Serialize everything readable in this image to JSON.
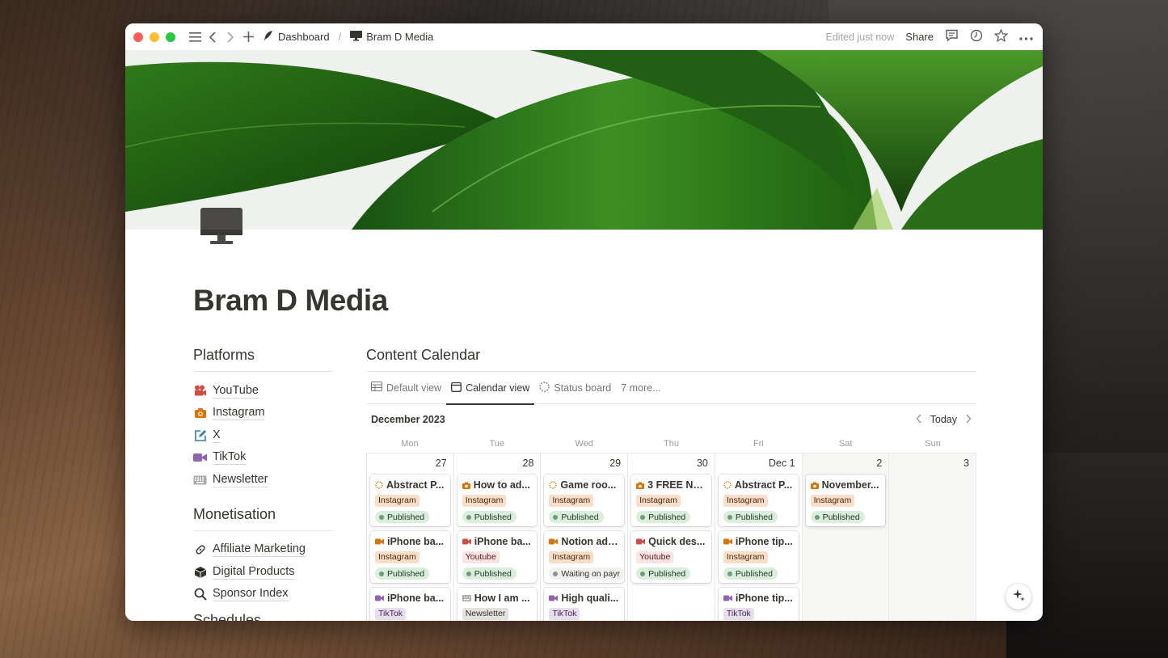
{
  "titlebar": {
    "breadcrumb_root": "Dashboard",
    "breadcrumb_separator": "/",
    "breadcrumb_page": "Bram D Media",
    "edited": "Edited just now",
    "share": "Share"
  },
  "page": {
    "title": "Bram D Media"
  },
  "platforms": {
    "title": "Platforms",
    "items": [
      {
        "label": "YouTube",
        "icon": "film-camera-icon",
        "color": "#d44c47"
      },
      {
        "label": "Instagram",
        "icon": "camera-icon",
        "color": "#d9730d"
      },
      {
        "label": "X",
        "icon": "edit-square-icon",
        "color": "#337ea9"
      },
      {
        "label": "TikTok",
        "icon": "video-icon",
        "color": "#9065b0"
      },
      {
        "label": "Newsletter",
        "icon": "keyboard-icon",
        "color": "#787774"
      }
    ]
  },
  "monetisation": {
    "title": "Monetisation",
    "items": [
      {
        "label": "Affiliate Marketing",
        "icon": "link-icon"
      },
      {
        "label": "Digital Products",
        "icon": "box-icon"
      },
      {
        "label": "Sponsor Index",
        "icon": "search-icon"
      }
    ]
  },
  "schedules": {
    "title": "Schedules"
  },
  "calendar": {
    "title": "Content Calendar",
    "tabs": [
      {
        "label": "Default view",
        "icon": "table-icon"
      },
      {
        "label": "Calendar view",
        "icon": "calendar-icon"
      },
      {
        "label": "Status board",
        "icon": "status-board-icon"
      },
      {
        "label": "7 more...",
        "icon": ""
      }
    ],
    "month": "December 2023",
    "today": "Today",
    "weekdays": [
      "Mon",
      "Tue",
      "Wed",
      "Thu",
      "Fri",
      "Sat",
      "Sun"
    ],
    "days": [
      {
        "num": "27",
        "cards": [
          {
            "title": "Abstract P...",
            "icon": "loading",
            "platform": "Instagram",
            "status": "Published"
          },
          {
            "title": "iPhone ba...",
            "icon": "video-orange",
            "platform": "Instagram",
            "status": "Published"
          },
          {
            "title": "iPhone ba...",
            "icon": "video-purple",
            "platform": "TikTok",
            "status": ""
          }
        ]
      },
      {
        "num": "28",
        "cards": [
          {
            "title": "How to ad...",
            "icon": "camera-orange",
            "platform": "Instagram",
            "status": "Published"
          },
          {
            "title": "iPhone ba...",
            "icon": "video-red",
            "platform": "Youtube",
            "status": "Published"
          },
          {
            "title": "How I am ...",
            "icon": "keyboard-grey",
            "platform": "Newsletter",
            "status": ""
          }
        ]
      },
      {
        "num": "29",
        "cards": [
          {
            "title": "Game roo...",
            "icon": "loading",
            "platform": "Instagram",
            "status": "Published"
          },
          {
            "title": "Notion ad:...",
            "icon": "video-orange",
            "platform": "Instagram",
            "status": "Waiting on payr"
          },
          {
            "title": "High quali...",
            "icon": "video-purple",
            "platform": "TikTok",
            "status": ""
          }
        ]
      },
      {
        "num": "30",
        "cards": [
          {
            "title": "3 FREE No...",
            "icon": "camera-orange",
            "platform": "Instagram",
            "status": "Published"
          },
          {
            "title": "Quick des...",
            "icon": "video-red",
            "platform": "Youtube",
            "status": "Published"
          }
        ]
      },
      {
        "num": "Dec 1",
        "cards": [
          {
            "title": "Abstract P...",
            "icon": "loading",
            "platform": "Instagram",
            "status": "Published"
          },
          {
            "title": "iPhone tip...",
            "icon": "video-orange",
            "platform": "Instagram",
            "status": "Published"
          },
          {
            "title": "iPhone tip...",
            "icon": "video-purple",
            "platform": "TikTok",
            "status": ""
          }
        ]
      },
      {
        "num": "2",
        "cards": [
          {
            "title": "November...",
            "icon": "camera-orange",
            "platform": "Instagram",
            "status": "Published"
          }
        ]
      },
      {
        "num": "3",
        "cards": []
      }
    ]
  },
  "colors": {
    "instagram_bg": "#fadec9",
    "youtube_bg": "#fbe4e4",
    "tiktok_bg": "#e8deee",
    "newsletter_bg": "#e3e2e0",
    "published_bg": "#dbeddb"
  }
}
